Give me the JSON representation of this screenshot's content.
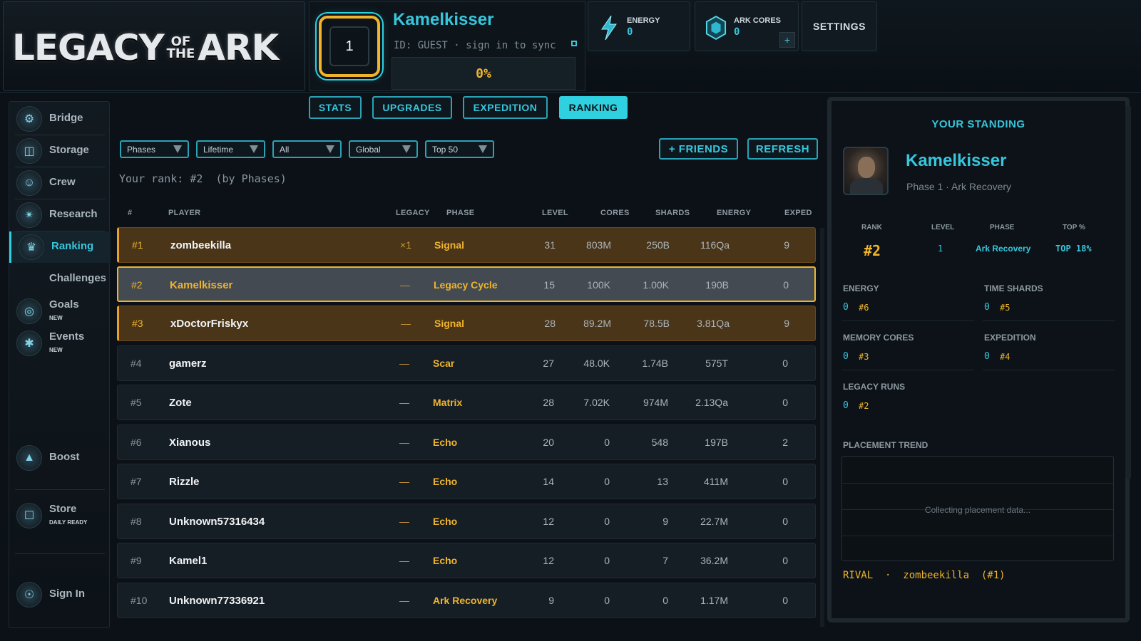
{
  "logo": {
    "part1": "LEGACY",
    "of": "OF",
    "the": "THE",
    "part2": "ARK"
  },
  "profile": {
    "level": "1",
    "name": "Kamelkisser",
    "id_text": "ID: GUEST · sign in to sync",
    "progress_text": "0%",
    "progress_value": 0
  },
  "resources": {
    "energy": {
      "label": "ENERGY",
      "value": "0",
      "icon": "lightning-icon"
    },
    "cores": {
      "label": "ARK CORES",
      "value": "0",
      "icon": "hexagon-core-icon",
      "plus": "+"
    }
  },
  "settings_label": "SETTINGS",
  "sidebar": {
    "items": [
      {
        "label": "Bridge",
        "icon": "bridge-icon"
      },
      {
        "label": "Storage",
        "icon": "storage-icon"
      },
      {
        "label": "Crew",
        "icon": "crew-icon"
      },
      {
        "label": "Research",
        "icon": "research-icon"
      },
      {
        "label": "Ranking",
        "icon": "ranking-icon"
      },
      {
        "label": "Challenges"
      },
      {
        "label": "Goals",
        "sub": "NEW",
        "icon": "goals-icon"
      },
      {
        "label": "Events",
        "sub": "NEW",
        "icon": "events-icon"
      },
      {
        "label": "Boost",
        "icon": "boost-icon"
      },
      {
        "label": "Store",
        "sub": "DAILY READY",
        "icon": "store-icon"
      },
      {
        "label": "Sign In",
        "icon": "sign-in-icon"
      }
    ]
  },
  "tabs": [
    "STATS",
    "UPGRADES",
    "EXPEDITION",
    "RANKING"
  ],
  "filters": [
    "Phases",
    "Lifetime",
    "All",
    "Global",
    "Top 50"
  ],
  "actions": {
    "friends": "+ FRIENDS",
    "refresh": "REFRESH"
  },
  "rank_summary": "Your rank: #2  (by Phases)",
  "table": {
    "headers": {
      "rank": "#",
      "player": "PLAYER",
      "legacy": "LEGACY",
      "phase": "PHASE",
      "level": "LEVEL",
      "cores": "CORES",
      "shards": "SHARDS",
      "energy": "ENERGY",
      "exped": "EXPED"
    },
    "rows": [
      {
        "rank": "#1",
        "player": "zombeekilla",
        "legacy": "×1",
        "phase": "Signal",
        "level": "31",
        "cores": "803M",
        "shards": "250B",
        "energy": "116Qa",
        "exped": "9"
      },
      {
        "rank": "#2",
        "player": "Kamelkisser",
        "legacy": "—",
        "phase": "Legacy Cycle",
        "level": "15",
        "cores": "100K",
        "shards": "1.00K",
        "energy": "190B",
        "exped": "0"
      },
      {
        "rank": "#3",
        "player": "xDoctorFriskyx",
        "legacy": "—",
        "phase": "Signal",
        "level": "28",
        "cores": "89.2M",
        "shards": "78.5B",
        "energy": "3.81Qa",
        "exped": "9"
      },
      {
        "rank": "#4",
        "player": "gamerz",
        "legacy": "—",
        "phase": "Scar",
        "level": "27",
        "cores": "48.0K",
        "shards": "1.74B",
        "energy": "575T",
        "exped": "0"
      },
      {
        "rank": "#5",
        "player": "Zote",
        "legacy": "—",
        "phase": "Matrix",
        "level": "28",
        "cores": "7.02K",
        "shards": "974M",
        "energy": "2.13Qa",
        "exped": "0"
      },
      {
        "rank": "#6",
        "player": "Xianous",
        "legacy": "—",
        "phase": "Echo",
        "level": "20",
        "cores": "0",
        "shards": "548",
        "energy": "197B",
        "exped": "2"
      },
      {
        "rank": "#7",
        "player": "Rizzle",
        "legacy": "—",
        "phase": "Echo",
        "level": "14",
        "cores": "0",
        "shards": "13",
        "energy": "411M",
        "exped": "0"
      },
      {
        "rank": "#8",
        "player": "Unknown57316434",
        "legacy": "—",
        "phase": "Echo",
        "level": "12",
        "cores": "0",
        "shards": "9",
        "energy": "22.7M",
        "exped": "0"
      },
      {
        "rank": "#9",
        "player": "Kamel1",
        "legacy": "—",
        "phase": "Echo",
        "level": "12",
        "cores": "0",
        "shards": "7",
        "energy": "36.2M",
        "exped": "0"
      },
      {
        "rank": "#10",
        "player": "Unknown77336921",
        "legacy": "—",
        "phase": "Ark Recovery",
        "level": "9",
        "cores": "0",
        "shards": "0",
        "energy": "1.17M",
        "exped": "0"
      }
    ]
  },
  "standing": {
    "title": "YOUR STANDING",
    "name": "Kamelkisser",
    "subtitle": "Phase 1 · Ark Recovery",
    "labels": {
      "rank": "RANK",
      "level": "LEVEL",
      "phase": "PHASE",
      "top": "TOP %"
    },
    "rank": "#2",
    "level": "1",
    "phase": "Ark Recovery",
    "top": "TOP 18%",
    "stats": [
      {
        "label": "ENERGY",
        "value": "0",
        "rank": "#6"
      },
      {
        "label": "TIME SHARDS",
        "value": "0",
        "rank": "#5"
      },
      {
        "label": "MEMORY CORES",
        "value": "0",
        "rank": "#3"
      },
      {
        "label": "EXPEDITION",
        "value": "0",
        "rank": "#4"
      },
      {
        "label": "LEGACY RUNS",
        "value": "0",
        "rank": "#2"
      }
    ],
    "trend_label": "PLACEMENT TREND",
    "trend_message": "Collecting placement data...",
    "rival": "RIVAL  ·  zombeekilla  (#1)"
  },
  "colors": {
    "accent": "#2fd0e0",
    "gold": "#f0b42c",
    "background": "#0b1117"
  }
}
